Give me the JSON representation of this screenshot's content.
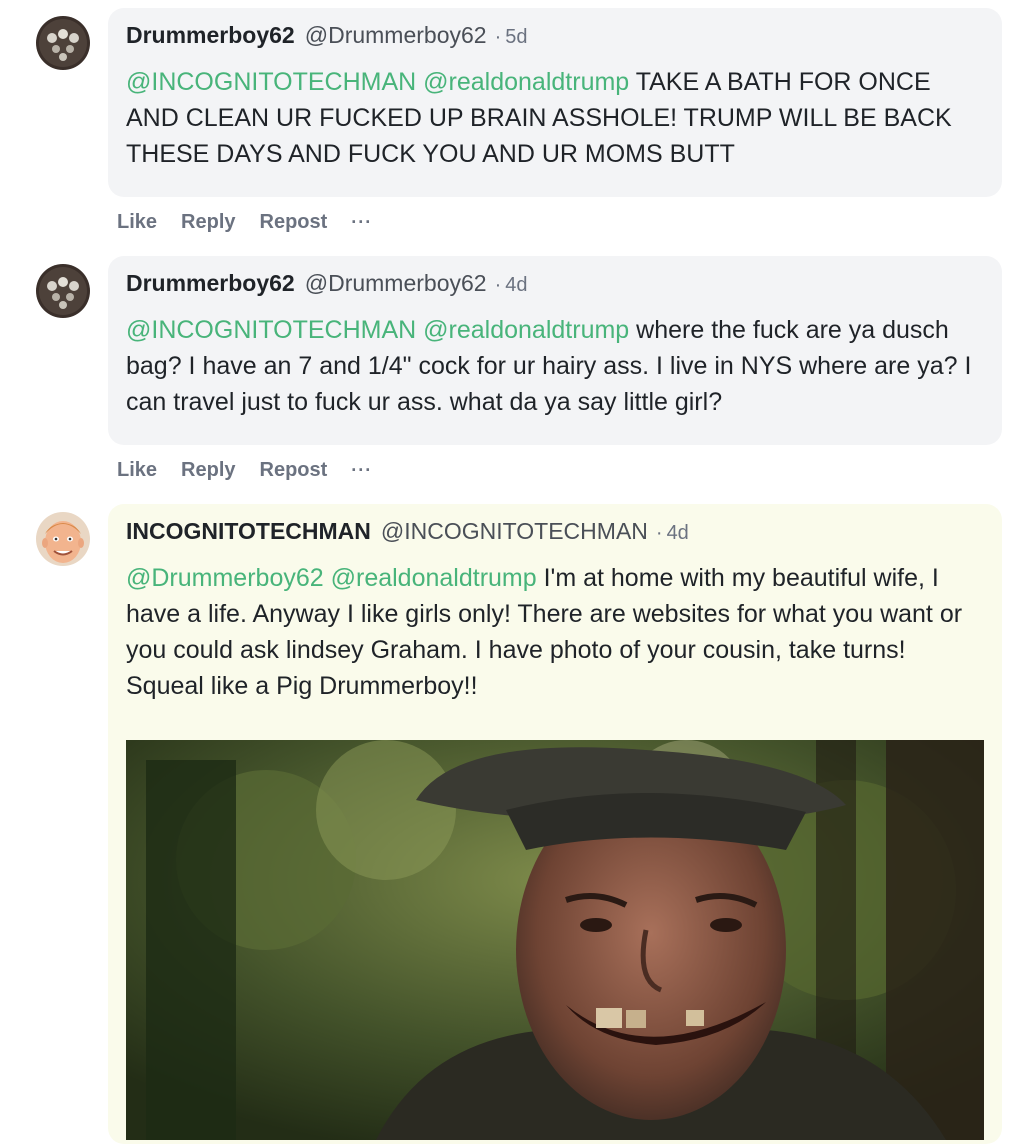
{
  "comments": [
    {
      "name": "Drummerboy62",
      "handle": "@Drummerboy62",
      "time": "5d",
      "mentions": [
        "@INCOGNITOTECHMAN",
        "@realdonaldtrump"
      ],
      "text": "TAKE A BATH FOR ONCE AND CLEAN UR FUCKED UP BRAIN ASSHOLE! TRUMP WILL BE BACK THESE DAYS AND FUCK YOU AND UR MOMS BUTT",
      "actions": {
        "like": "Like",
        "reply": "Reply",
        "repost": "Repost",
        "more": "···"
      }
    },
    {
      "name": "Drummerboy62",
      "handle": "@Drummerboy62",
      "time": "4d",
      "mentions": [
        "@INCOGNITOTECHMAN",
        "@realdonaldtrump"
      ],
      "text": "where the fuck are ya dusch bag? I have an 7 and 1/4\" cock for ur hairy ass. I live in NYS where are ya? I can travel just to fuck ur ass. what da ya say little girl?",
      "actions": {
        "like": "Like",
        "reply": "Reply",
        "repost": "Repost",
        "more": "···"
      }
    },
    {
      "name": "INCOGNITOTECHMAN",
      "handle": "@INCOGNITOTECHMAN",
      "time": "4d",
      "mentions": [
        "@Drummerboy62",
        "@realdonaldtrump"
      ],
      "text": "I'm at home with my beautiful wife, I have a life. Anyway I like girls only! There are websites for what you want or you could ask lindsey Graham. I have photo of your cousin, take turns! Squeal like a Pig Drummerboy!!"
    }
  ],
  "separator": "·",
  "colors": {
    "mention": "#48b47a",
    "bubble": "#f3f4f6",
    "op_bubble": "#fafbeb",
    "muted": "#6b7280"
  }
}
